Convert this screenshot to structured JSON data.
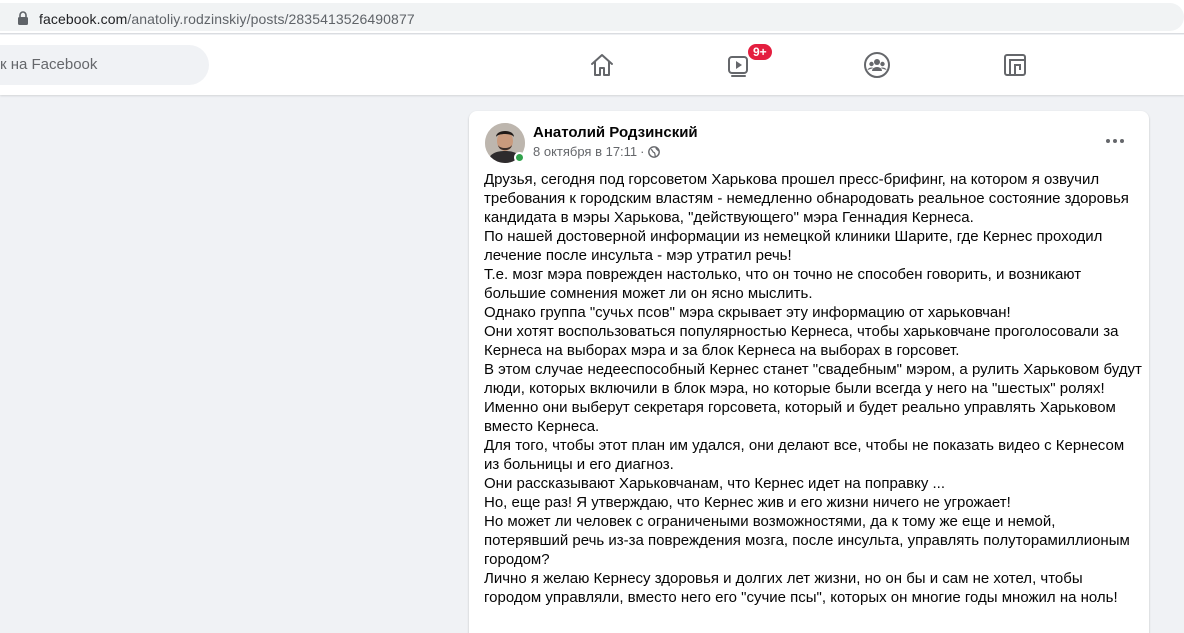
{
  "browser": {
    "url_domain": "facebook.com",
    "url_path": "/anatoliy.rodzinskiy/posts/2835413526490877"
  },
  "nav": {
    "search_placeholder": "к на Facebook",
    "watch_badge": "9+",
    "icons": [
      "home-icon",
      "watch-icon",
      "groups-icon",
      "gaming-icon"
    ]
  },
  "post": {
    "author": "Анатолий Родзинский",
    "date": "8 октября в 17:11",
    "separator": "·",
    "privacy_icon": "globe-icon",
    "lines": [
      "Друзья, сегодня под горсоветом Харькова прошел пресс-брифинг, на котором я озвучил",
      "требования к городским властям - немедленно обнародовать реальное состояние здоровья",
      "кандидата в мэры Харькова, \"действующего\" мэра Геннадия Кернеса.",
      "По нашей достоверной информации из немецкой клиники Шарите, где Кернес проходил",
      "лечение после инсульта - мэр утратил речь!",
      "Т.е. мозг мэра поврежден настолько, что он точно не способен говорить, и возникают",
      "большие сомнения может ли он ясно мыслить.",
      "Однако группа \"сучьх псов\" мэра скрывает эту информацию от харьковчан!",
      "Они хотят воспользоваться популярностью Кернеса, чтобы харьковчане проголосовали за",
      "Кернеса на выборах мэра и за блок Кернеса на выборах в горсовет.",
      "В этом случае недееспособный Кернес станет \"свадебным\" мэром, а рулить Харьковом будут",
      "люди, которых включили в блок мэра, но которые были всегда у него на \"шестых\" ролях!",
      "Именно они выберут секретаря горсовета, который и будет реально управлять Харьковом",
      "вместо Кернеса.",
      "Для того, чтобы этот план им удался, они делают все, чтобы не показать видео с Кернесом",
      "из больницы и его диагноз.",
      "Они рассказывают Харьковчанам, что Кернес идет на поправку ...",
      "Но, еще раз! Я утверждаю, что Кернес жив и его жизни ничего не угрожает!",
      "Но может ли человек с ограничеными возможностями, да к тому же еще и немой,",
      "потерявший речь из-за повреждения мозга, после инсульта, управлять полутoрамиллионым",
      "городом?",
      "Лично я желаю Кернесу здоровья и долгих лет жизни, но он бы и сам не хотел, чтобы",
      "городом управляли, вместо него его \"сучие псы\", которых он многие годы множил на ноль!"
    ]
  },
  "colors": {
    "fb_bg": "#f0f2f5",
    "text_primary": "#050505",
    "text_secondary": "#65676b",
    "badge_red": "#e41e3f",
    "online_green": "#31a24c"
  }
}
